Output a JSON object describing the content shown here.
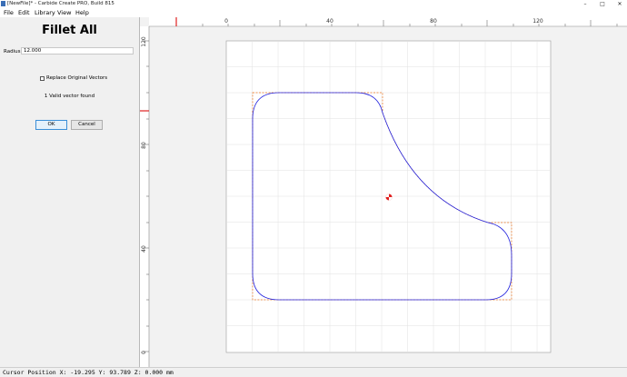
{
  "window": {
    "title": "[NewFile]* - Carbide Create PRO, Build 815"
  },
  "menu": [
    "File",
    "Edit",
    "Library",
    "View",
    "Help"
  ],
  "panel": {
    "heading": "Fillet All",
    "radius_label": "Radius",
    "radius_value": "12.000",
    "replace_label": "Replace Original Vectors",
    "status": "1 Valid vector found",
    "ok_label": "OK",
    "cancel_label": "Cancel"
  },
  "ruler": {
    "top_labels": [
      "0",
      "40",
      "80",
      "120"
    ],
    "left_labels": [
      "120",
      "80",
      "40",
      "0"
    ]
  },
  "statusbar": {
    "text": "Cursor Position X: -19.295 Y: 93.789 Z: 0.000 mm"
  },
  "colors": {
    "vector": "#2222dd",
    "original": "#ee7722",
    "ruler_marker": "#e02020",
    "origin": "#e02020"
  },
  "icons": {
    "origin": "origin-marker-icon"
  }
}
